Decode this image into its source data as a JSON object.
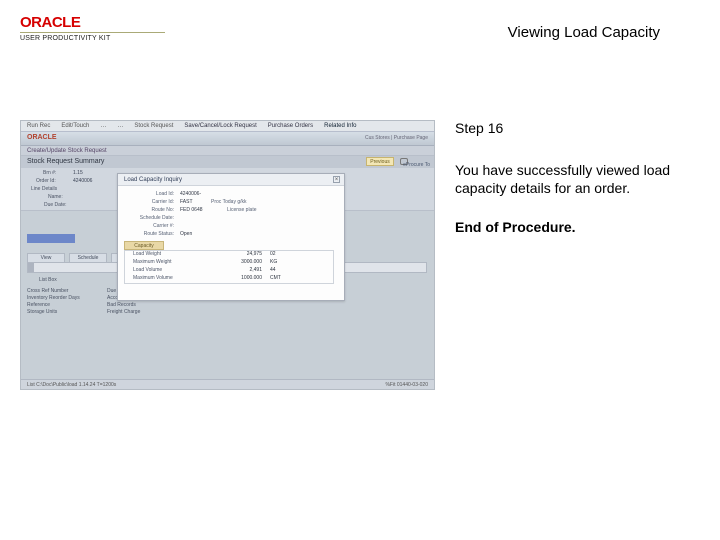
{
  "brand": {
    "name": "ORACLE",
    "sub": "USER PRODUCTIVITY KIT"
  },
  "page_title": "Viewing Load Capacity",
  "step": {
    "label": "Step 16"
  },
  "description": "You have successfully viewed load capacity details for an order.",
  "end": "End of Procedure.",
  "app": {
    "menubar": [
      "Run Rec",
      "Edit/Touch",
      "…",
      "…",
      "Stock Request",
      "Save/Cancel/Lock Request",
      "Purchase Orders",
      "Related Info"
    ],
    "brand": "ORACLE",
    "brand_right": "Cus Stores  |  Purchase Page",
    "crumb": "Create/Update Stock Request",
    "summary_title": "Stock Request Summary",
    "prev_btn": "Previous",
    "eproc": "eProcure To",
    "form": {
      "branch_lbl": "Brn #:",
      "branch_val": "1.15",
      "order_lbl": "Order Id:",
      "order_val": "4240006",
      "line_lbl": "Line Details",
      "name_lbl": "Name:",
      "due_lbl": "Due Date:"
    },
    "tabs": [
      "View",
      "Schedule",
      "ETR"
    ],
    "listbox_label": "List Box",
    "detail_rows": [
      [
        "Cross Ref Number",
        "Due Dt / Time Table"
      ],
      [
        "Inventory Reorder Days",
        "Accounting Units"
      ],
      [
        "Reference",
        "Bad Records"
      ],
      [
        "Storage Units",
        "Freight Charge"
      ]
    ],
    "status_left": "List   C:\\Doc\\Public\\load   1.14.24   T=1200s",
    "status_right": "%Fit   01440-03-020"
  },
  "popup": {
    "title": "Load Capacity Inquiry",
    "rows": [
      {
        "k": "Load Id:",
        "v": "4240006-"
      },
      {
        "k": "Carrier Id:",
        "v": "FAST",
        "v2l": "Proc Today g/kk",
        "v2": ""
      },
      {
        "k": "Route No:",
        "v": "FED 0648",
        "v2l": "License plate",
        "v2": ""
      },
      {
        "k": "Schedule Date:",
        "v": ""
      },
      {
        "k": "Carrier #:",
        "v": ""
      },
      {
        "k": "Route Status:",
        "v": "Open"
      }
    ],
    "cap_tab": "Capacity",
    "grid": [
      {
        "k": "Load Weight",
        "v1": "24,975",
        "v2": "02"
      },
      {
        "k": "Maximum Weight",
        "v1": "3000.000",
        "v2": "KG"
      },
      {
        "k": "Load Volume",
        "v1": "2,491",
        "v2": "44"
      },
      {
        "k": "Maximum Volume",
        "v1": "1000.000",
        "v2": "CMT"
      }
    ]
  }
}
